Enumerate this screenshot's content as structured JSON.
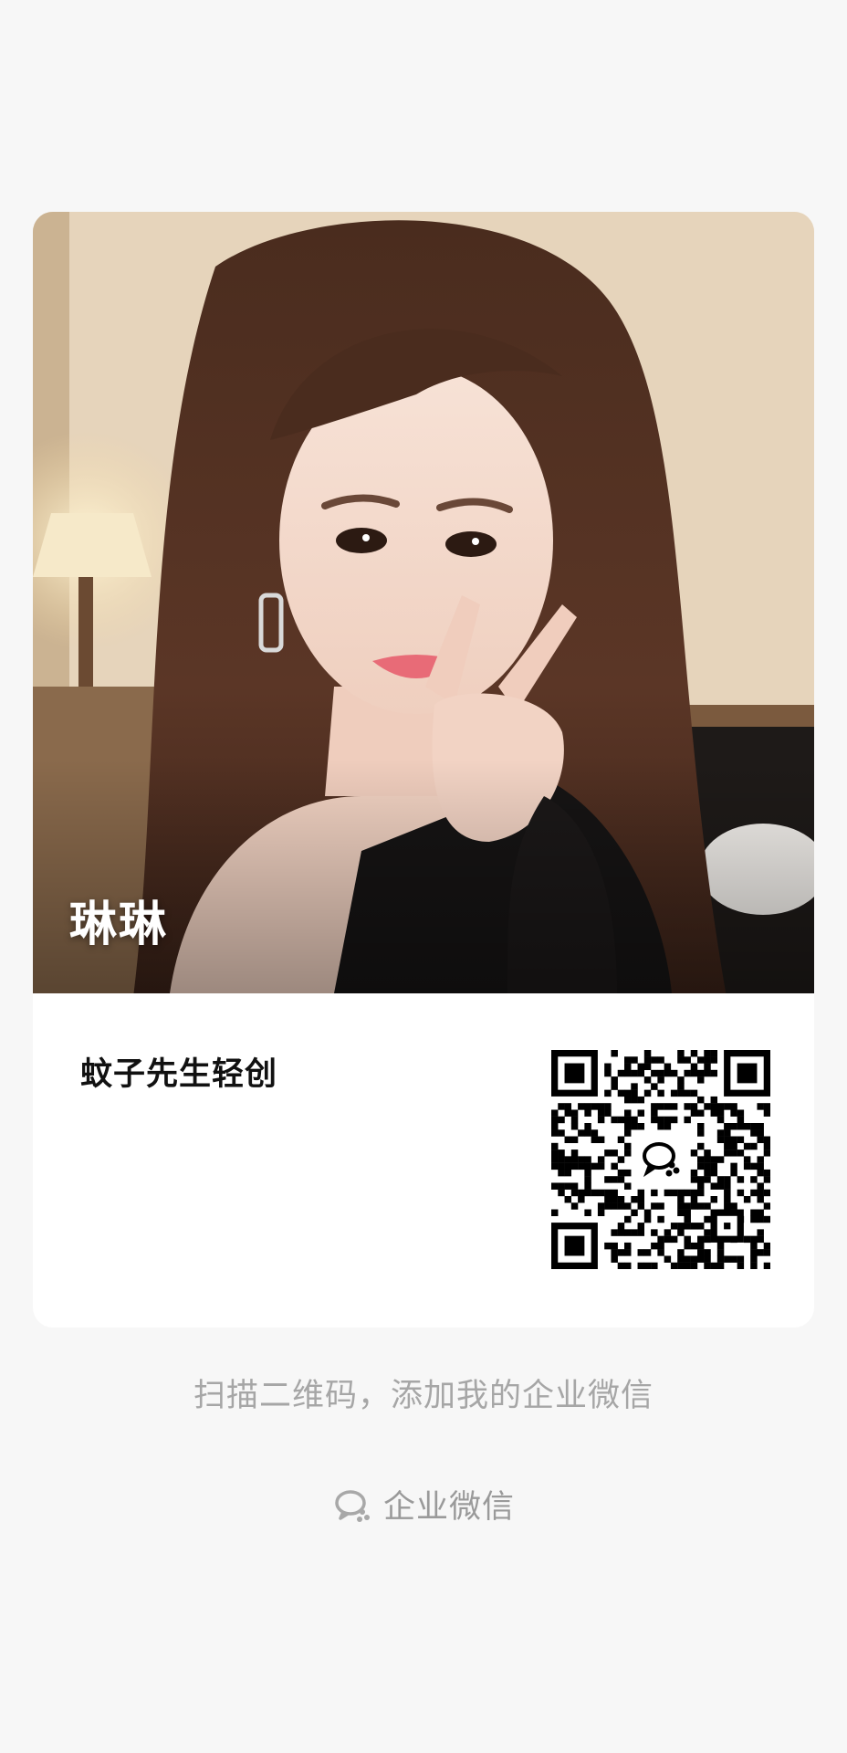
{
  "card": {
    "person_name": "琳琳",
    "company_name": "蚊子先生轻创",
    "photo_icon": "profile-photo",
    "qr_icon": "qr-code-icon"
  },
  "footer": {
    "hint_text": "扫描二维码，添加我的企业微信",
    "brand_label": "企业微信",
    "brand_icon": "wecom-logo-icon"
  },
  "colors": {
    "background": "#f7f7f7",
    "card": "#ffffff",
    "hint_text": "#a6a6a6",
    "brand_text": "#9a9a9a"
  }
}
